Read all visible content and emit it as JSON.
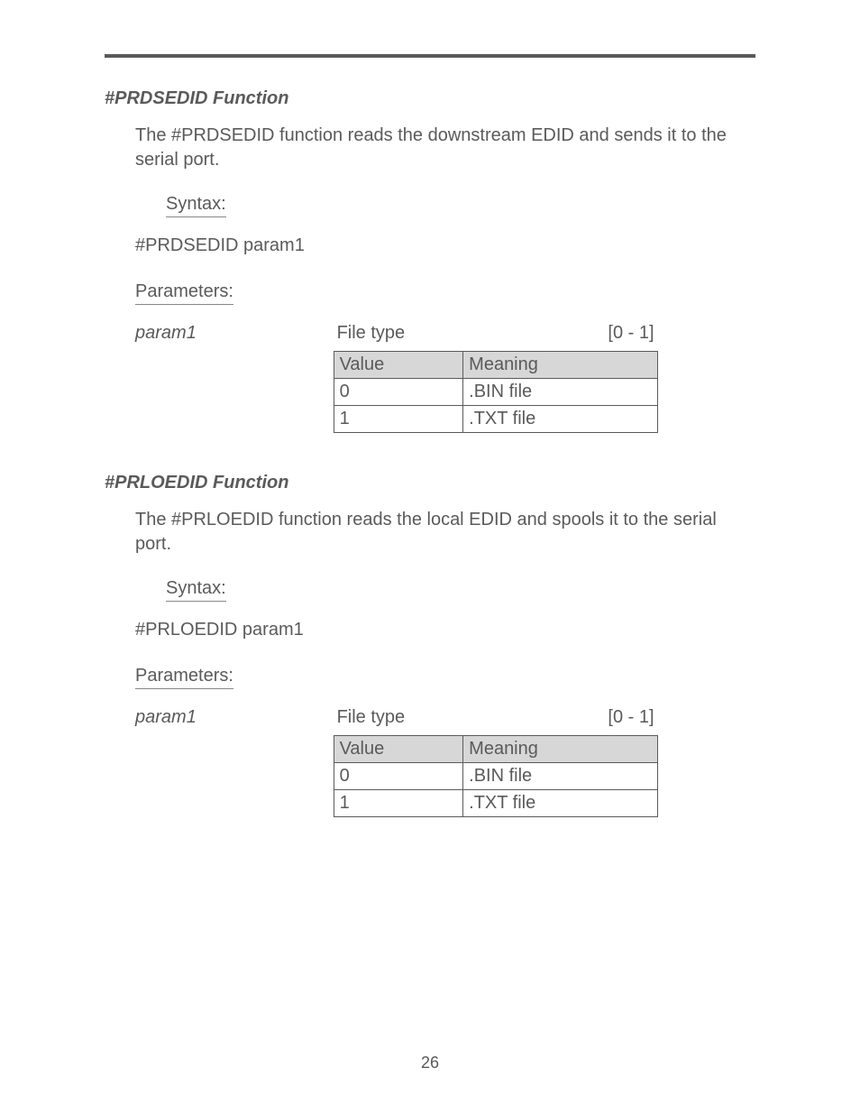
{
  "section1": {
    "title": "#PRDSEDID Function",
    "body": "The #PRDSEDID function reads the downstream EDID and sends it to the serial port.",
    "syntax_label": "Syntax:",
    "syntax_code": "#PRDSEDID param1",
    "parameters_label": "Parameters:",
    "param_left": "param1",
    "param_desc": "File type",
    "param_range": "[0 - 1]",
    "table": {
      "headers": [
        "Value",
        "Meaning"
      ],
      "rows": [
        [
          "0",
          ".BIN file"
        ],
        [
          "1",
          ".TXT file"
        ]
      ]
    }
  },
  "section2": {
    "title": "#PRLOEDID Function",
    "body": "The #PRLOEDID function reads the local EDID and spools it to the serial port.",
    "syntax_label": "Syntax:",
    "syntax_code": "#PRLOEDID param1",
    "parameters_label": "Parameters:",
    "param_left": "param1",
    "param_desc": "File type",
    "param_range": "[0 - 1]",
    "table": {
      "headers": [
        "Value",
        "Meaning"
      ],
      "rows": [
        [
          "0",
          ".BIN file"
        ],
        [
          "1",
          ".TXT file"
        ]
      ]
    }
  },
  "footer": "26"
}
